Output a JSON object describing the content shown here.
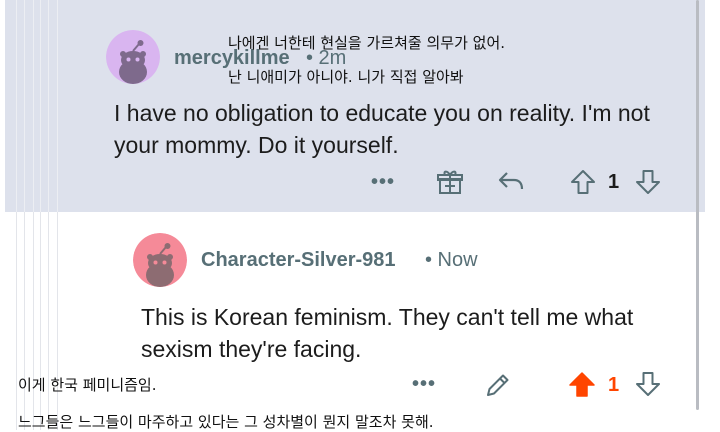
{
  "comments": [
    {
      "username": "mercykillme",
      "time": "• 2m",
      "body": "I have no obligation to educate you on reality. I'm not your mommy. Do it yourself.",
      "overlay_translation_line1": "나에겐 너한테 현실을 가르쳐줄 의무가 없어.",
      "overlay_translation_line2": "난 니애미가 아니야. 니가 직접 알아봐",
      "more_label": "•••",
      "vote_count": "1",
      "avatar_color": "#d9b5f0",
      "highlight_bg": "#dde1ec"
    },
    {
      "username": "Character-Silver-981",
      "time": "• Now",
      "body": "This is Korean feminism. They can't tell me what sexism they're facing.",
      "more_label": "•••",
      "vote_count": "1",
      "avatar_color": "#f58a98",
      "upvote_color": "#ff4500"
    }
  ],
  "caption": {
    "line1": "이게 한국 페미니즘임.",
    "line2": "느그들은 느그들이 마주하고 있다는 그 성차별이 뭔지 말조차 못해."
  }
}
